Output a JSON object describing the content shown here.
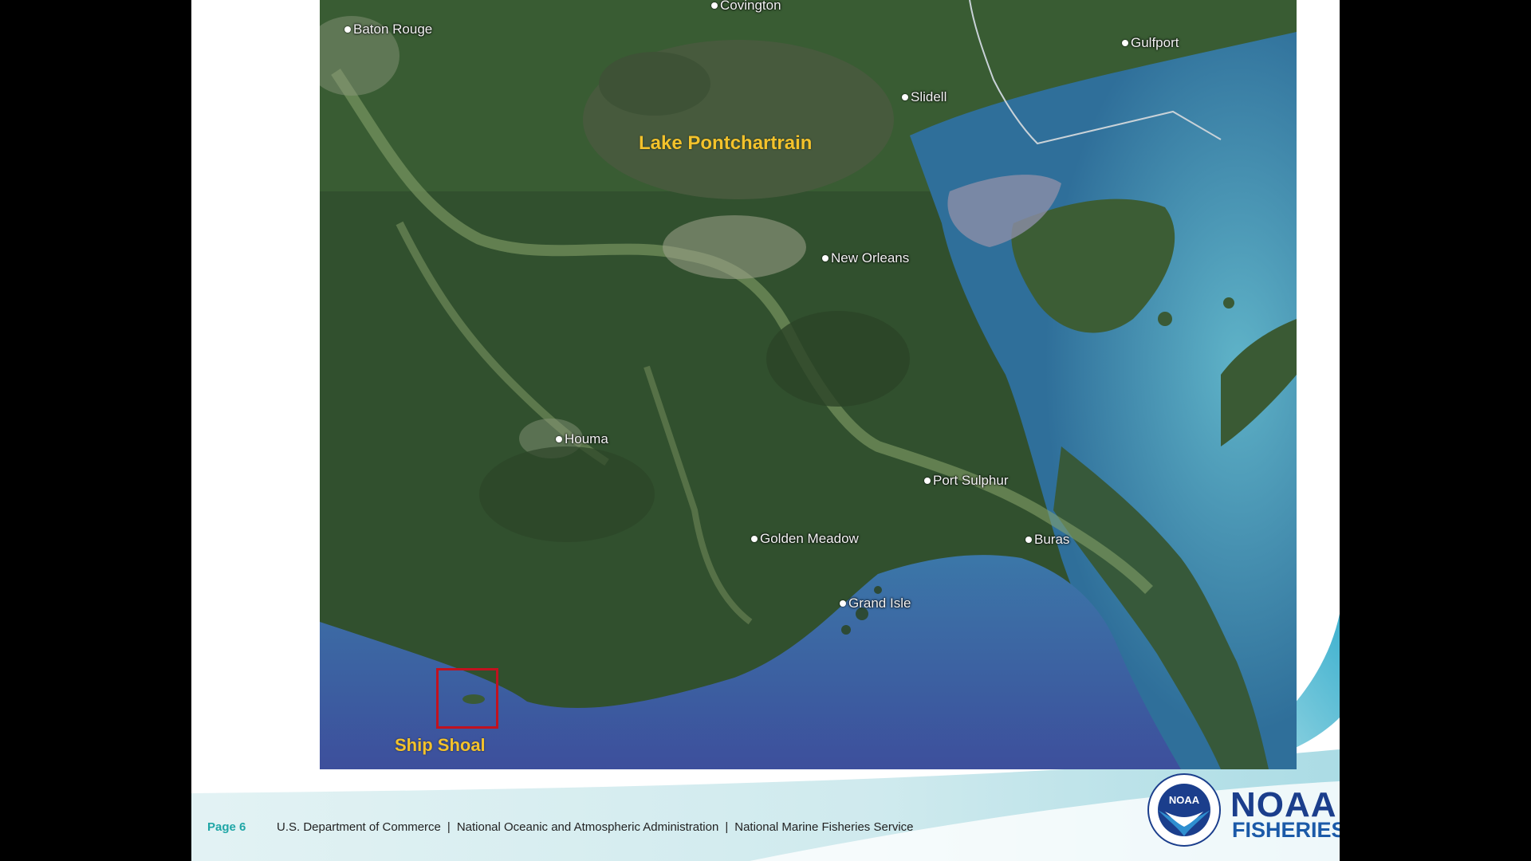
{
  "slide": {
    "map": {
      "water_label": "Lake Pontchartrain",
      "highlight_label": "Ship Shoal",
      "cities": [
        {
          "id": "baton-rouge",
          "label": "Baton Rouge"
        },
        {
          "id": "covington",
          "label": "Covington"
        },
        {
          "id": "gulfport",
          "label": "Gulfport"
        },
        {
          "id": "slidell",
          "label": "Slidell"
        },
        {
          "id": "new-orleans",
          "label": "New Orleans"
        },
        {
          "id": "houma",
          "label": "Houma"
        },
        {
          "id": "port-sulphur",
          "label": "Port Sulphur"
        },
        {
          "id": "buras",
          "label": "Buras"
        },
        {
          "id": "golden-meadow",
          "label": "Golden Meadow"
        },
        {
          "id": "grand-isle",
          "label": "Grand Isle"
        }
      ]
    },
    "footer": {
      "page": "Page 6",
      "dept": "U.S. Department of Commerce",
      "noaa": "National Oceanic and Atmospheric Administration",
      "nmfs": "National Marine Fisheries Service",
      "separator": "|"
    },
    "logo": {
      "emblem_text": "NOAA",
      "word1": "NOAA",
      "word2": "FISHERIES"
    }
  },
  "colors": {
    "label_yellow": "#f3c22b",
    "highlight_red": "#c1121f",
    "page_teal": "#1fa6a6",
    "noaa_blue": "#1b3e8c"
  }
}
